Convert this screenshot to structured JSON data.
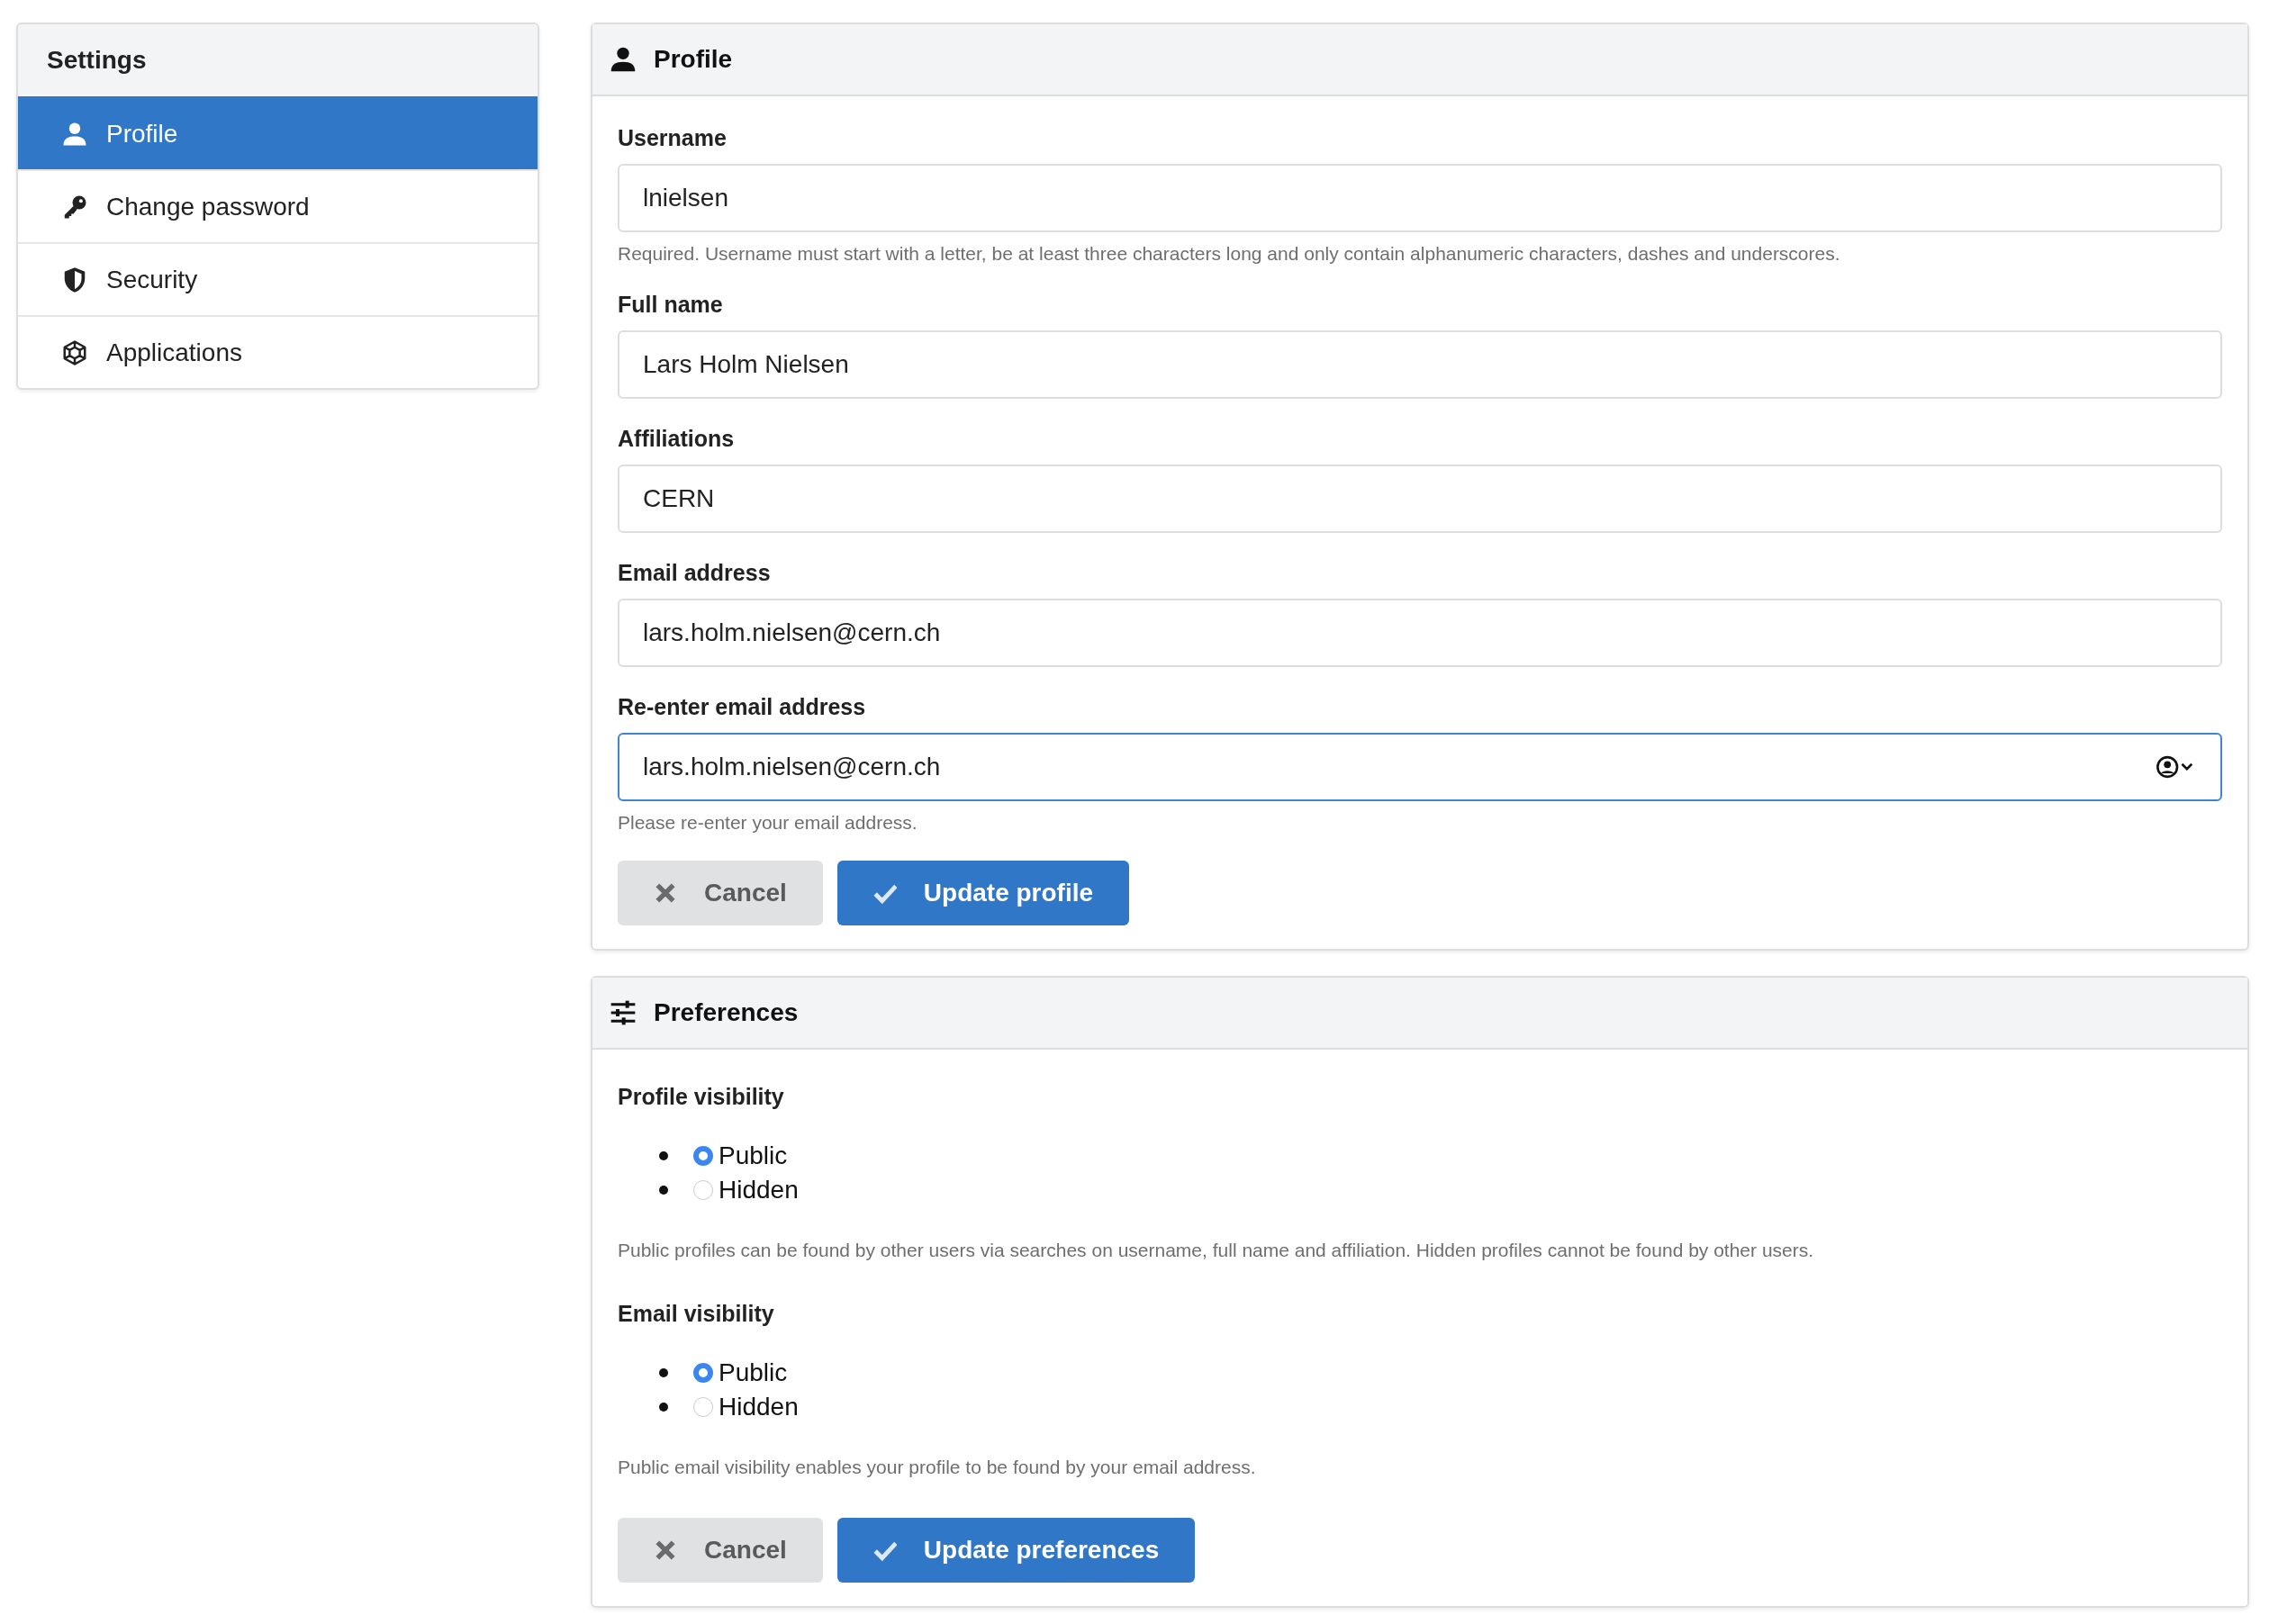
{
  "sidebar": {
    "title": "Settings",
    "items": [
      {
        "label": "Profile",
        "selected": true
      },
      {
        "label": "Change password",
        "selected": false
      },
      {
        "label": "Security",
        "selected": false
      },
      {
        "label": "Applications",
        "selected": false
      }
    ]
  },
  "profile": {
    "title": "Profile",
    "fields": [
      {
        "label": "Username",
        "value": "lnielsen",
        "help": "Required. Username must start with a letter, be at least three characters long and only contain alphanumeric characters, dashes and underscores.",
        "focused": false,
        "autofill": false
      },
      {
        "label": "Full name",
        "value": "Lars Holm Nielsen",
        "focused": false,
        "autofill": false
      },
      {
        "label": "Affiliations",
        "value": "CERN",
        "focused": false,
        "autofill": false
      },
      {
        "label": "Email address",
        "value": "lars.holm.nielsen@cern.ch",
        "focused": false,
        "autofill": false
      },
      {
        "label": "Re-enter email address",
        "value": "lars.holm.nielsen@cern.ch",
        "help": "Please re-enter your email address.",
        "focused": true,
        "autofill": true
      }
    ],
    "buttons": [
      {
        "kind": "cancel",
        "label": "Cancel"
      },
      {
        "kind": "submit",
        "label": "Update profile"
      }
    ]
  },
  "preferences": {
    "title": "Preferences",
    "groups": [
      {
        "label": "Profile visibility",
        "options": [
          {
            "label": "Public",
            "selected": true
          },
          {
            "label": "Hidden",
            "selected": false
          }
        ],
        "help": "Public profiles can be found by other users via searches on username, full name and affiliation. Hidden profiles cannot be found by other users."
      },
      {
        "label": "Email visibility",
        "options": [
          {
            "label": "Public",
            "selected": true
          },
          {
            "label": "Hidden",
            "selected": false
          }
        ],
        "help": "Public email visibility enables your profile to be found by your email address."
      }
    ],
    "buttons": [
      {
        "kind": "cancel",
        "label": "Cancel"
      },
      {
        "kind": "submit",
        "label": "Update preferences"
      }
    ]
  }
}
